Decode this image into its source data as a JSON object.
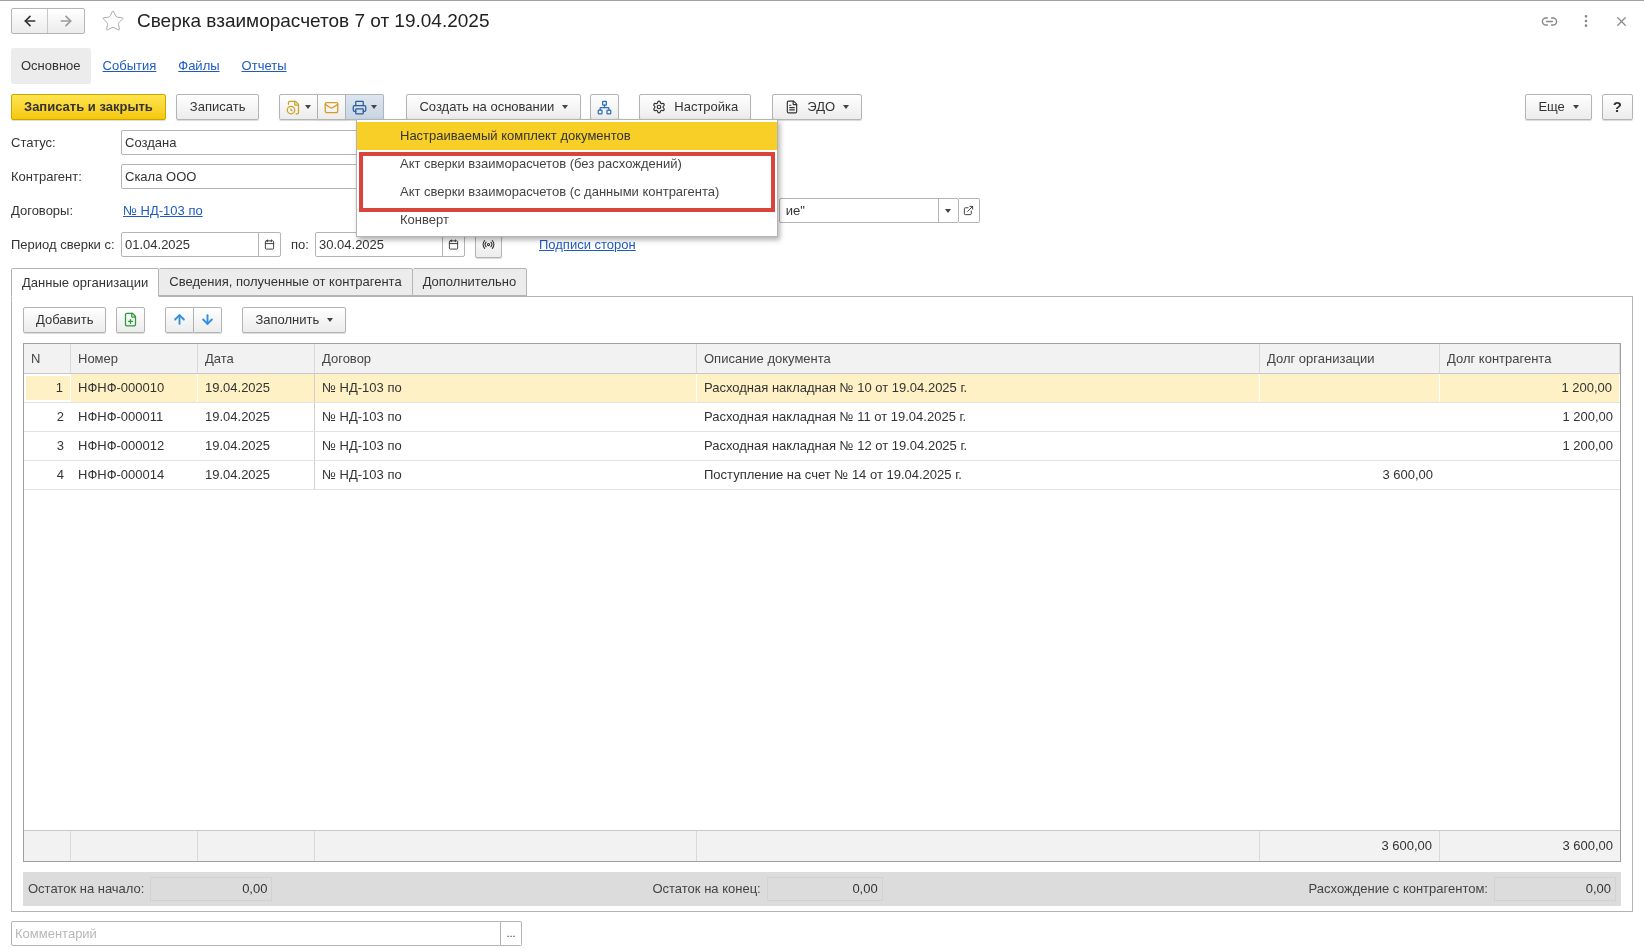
{
  "header": {
    "title": "Сверка взаиморасчетов 7 от 19.04.2025",
    "favorite": false
  },
  "nav_tabs": [
    {
      "label": "Основное",
      "selected": true
    },
    {
      "label": "События",
      "selected": false
    },
    {
      "label": "Файлы",
      "selected": false
    },
    {
      "label": "Отчеты",
      "selected": false
    }
  ],
  "toolbar": {
    "save_close": "Записать и закрыть",
    "save": "Записать",
    "create_based": "Создать на основании",
    "settings": "Настройка",
    "edo": "ЭДО",
    "more": "Еще",
    "help": "?"
  },
  "print_menu": {
    "open": true,
    "items": [
      {
        "label": "Настраиваемый комплект документов",
        "selected": true,
        "framed": false
      },
      {
        "label": "Акт сверки взаиморасчетов (без расхождений)",
        "selected": false,
        "framed": true
      },
      {
        "label": "Акт сверки взаиморасчетов (с данными контрагента)",
        "selected": false,
        "framed": true
      },
      {
        "label": "Конверт",
        "selected": false,
        "framed": false
      }
    ]
  },
  "form": {
    "status": {
      "label": "Статус:",
      "value": "Создана"
    },
    "counterparty": {
      "label": "Контрагент:",
      "value": "Скала ООО"
    },
    "contracts": {
      "label": "Договоры:",
      "link": "№ НД-103 по",
      "field_value": "ие\""
    },
    "period": {
      "label": "Период сверки с:",
      "from": "01.04.2025",
      "to_label": "по:",
      "to": "30.04.2025",
      "signatures_link": "Подписи сторон"
    }
  },
  "tabs": [
    {
      "label": "Данные организации",
      "selected": true
    },
    {
      "label": "Сведения, полученные от контрагента",
      "selected": false
    },
    {
      "label": "Дополнительно",
      "selected": false
    }
  ],
  "table_toolbar": {
    "add": "Добавить",
    "fill": "Заполнить"
  },
  "table": {
    "columns": [
      "N",
      "Номер",
      "Дата",
      "Договор",
      "Описание документа",
      "Долг организации",
      "Долг контрагента"
    ],
    "rows": [
      {
        "selected": true,
        "cells": [
          "1",
          "НФНФ-000010",
          "19.04.2025",
          "№ НД-103 по",
          "Расходная накладная № 10 от 19.04.2025 г.",
          null,
          "1 200,00"
        ]
      },
      {
        "selected": false,
        "cells": [
          "2",
          "НФНФ-000011",
          "19.04.2025",
          "№ НД-103 по",
          "Расходная накладная № 11 от 19.04.2025 г.",
          null,
          "1 200,00"
        ]
      },
      {
        "selected": false,
        "cells": [
          "3",
          "НФНФ-000012",
          "19.04.2025",
          "№ НД-103 по",
          "Расходная накладная № 12 от 19.04.2025 г.",
          null,
          "1 200,00"
        ]
      },
      {
        "selected": false,
        "cells": [
          "4",
          "НФНФ-000014",
          "19.04.2025",
          "№ НД-103 по",
          "Поступление на счет № 14 от 19.04.2025 г.",
          "3 600,00",
          null
        ]
      }
    ],
    "totals": {
      "org_debt": "3 600,00",
      "counterparty_debt": "3 600,00"
    }
  },
  "summary": [
    {
      "label": "Остаток на начало:",
      "value": "0,00"
    },
    {
      "label": "Остаток на конец:",
      "value": "0,00"
    },
    {
      "label": "Расхождение с контрагентом:",
      "value": "0,00"
    }
  ],
  "comment": {
    "placeholder": "Комментарий",
    "button": "..."
  }
}
